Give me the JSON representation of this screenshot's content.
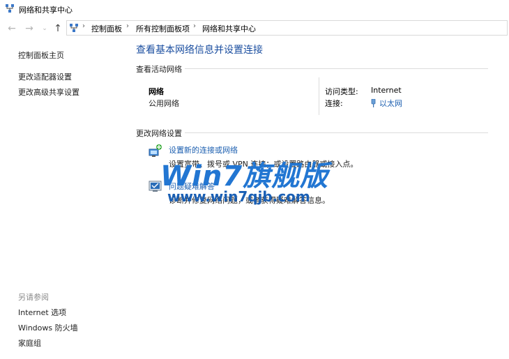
{
  "window": {
    "title": "网络和共享中心"
  },
  "navigation": {
    "back_icon": "arrow-left-icon",
    "forward_icon": "arrow-right-icon",
    "recent_icon": "chevron-down-icon",
    "up_icon": "arrow-up-icon",
    "breadcrumbs": [
      "控制面板",
      "所有控制面板项",
      "网络和共享中心"
    ]
  },
  "sidebar": {
    "items": [
      "控制面板主页",
      "更改适配器设置",
      "更改高级共享设置"
    ],
    "see_also_label": "另请参阅",
    "see_also_items": [
      "Internet 选项",
      "Windows 防火墙",
      "家庭组"
    ]
  },
  "main": {
    "title": "查看基本网络信息并设置连接",
    "active_networks_heading": "查看活动网络",
    "network": {
      "name": "网络",
      "type": "公用网络",
      "access_type_label": "访问类型:",
      "access_type_value": "Internet",
      "connections_label": "连接:",
      "connection_value": "以太网"
    },
    "change_settings_heading": "更改网络设置",
    "tasks": [
      {
        "link": "设置新的连接或网络",
        "description": "设置宽带、拨号或 VPN 连接；或设置路由器或接入点。",
        "icon": "network-setup-icon"
      },
      {
        "link": "问题疑难解答",
        "description": "诊断并修复网络问题，或者获得疑难解答信息。",
        "icon": "troubleshoot-icon"
      }
    ]
  },
  "watermark": {
    "line1": "Win7旗舰版",
    "line2": "www.win7qjb.com"
  },
  "colors": {
    "link": "#1c5fb0",
    "title": "#1c4fa0",
    "watermark": "#2276d2"
  }
}
